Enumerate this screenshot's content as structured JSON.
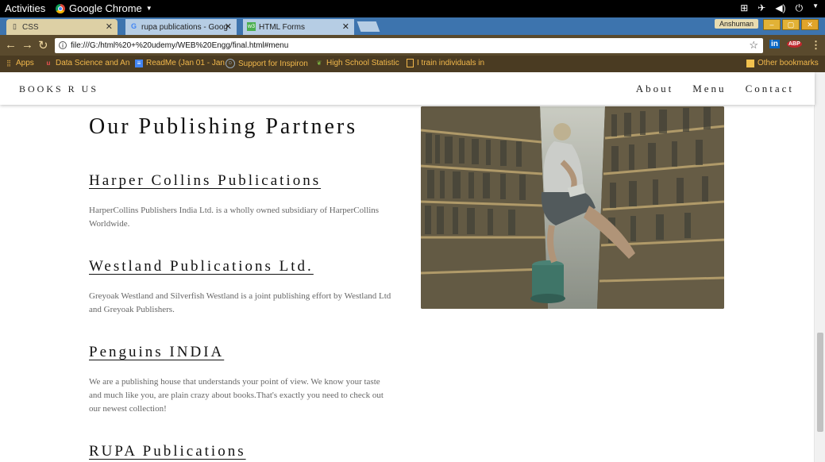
{
  "system": {
    "activities": "Activities",
    "app_name": "Google Chrome",
    "user": "Anshuman"
  },
  "tabs": [
    {
      "label": "CSS"
    },
    {
      "label": "rupa publications - Goog"
    },
    {
      "label": "HTML Forms"
    }
  ],
  "address": {
    "url": "file:///G:/html%20+%20udemy/WEB%20Engg/final.html#menu"
  },
  "bookmarks": [
    {
      "label": "Apps"
    },
    {
      "label": "Data Science and An"
    },
    {
      "label": "ReadMe (Jan 01 - Jan"
    },
    {
      "label": "Support for Inspiron"
    },
    {
      "label": "High School Statistic"
    },
    {
      "label": "I train individuals in"
    },
    {
      "label": "Other bookmarks"
    }
  ],
  "site": {
    "brand": "BOOKS R US",
    "nav": [
      "About",
      "Menu",
      "Contact"
    ],
    "heading": "Our Publishing Partners",
    "publishers": [
      {
        "name": "Harper Collins Publications",
        "desc": "HarperCollins Publishers India Ltd. is a wholly owned subsidiary of HarperCollins Worldwide."
      },
      {
        "name": "Westland Publications Ltd.",
        "desc": "Greyoak Westland and Silverfish Westland is a joint publishing effort by Westland Ltd and Greyoak Publishers."
      },
      {
        "name": "Penguins INDIA",
        "desc": "We are a publishing house that understands your point of view. We know your taste and much like you, are plain crazy about books.That's exactly you need to check out our newest collection!"
      },
      {
        "name": "RUPA Publications",
        "desc": ""
      }
    ]
  },
  "colors": {
    "tab_bar": "#3d74ae",
    "toolbar": "#5a4a2d",
    "bookmark_text": "#f2b84b"
  }
}
